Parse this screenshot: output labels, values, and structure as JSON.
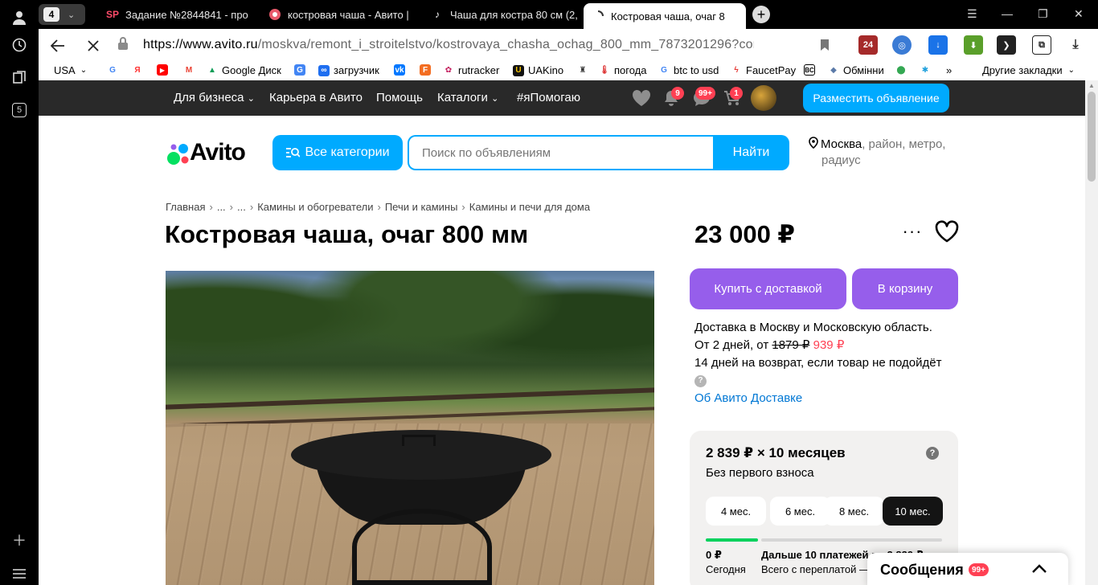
{
  "browser": {
    "tab_count": "4",
    "tabs": [
      {
        "favicon": "SP",
        "label": "Задание №2844841 - про"
      },
      {
        "favicon": "avito-icon",
        "label": "костровая чаша - Авито |"
      },
      {
        "favicon": "music-icon",
        "label": "Чаша для костра 80 см (2,"
      },
      {
        "favicon": "loading-icon",
        "label": "Костровая чаша, очаг 8"
      }
    ],
    "rail_badge": "5",
    "url_host": "https://www.avito.ru",
    "url_path": "/moskva/remont_i_stroitelstvo/kostrovaya_chasha_ochag_800_mm_7873201296?con...",
    "extension_badge": "24"
  },
  "bookmarks": [
    {
      "label": "USA",
      "icon": "chevron-down-icon"
    },
    {
      "label": "",
      "icon": "google-icon"
    },
    {
      "label": "",
      "icon": "yandex-icon"
    },
    {
      "label": "",
      "icon": "youtube-icon"
    },
    {
      "label": "",
      "icon": "gmail-icon"
    },
    {
      "label": "Google Диск",
      "icon": "google-drive-icon"
    },
    {
      "label": "",
      "icon": "translate-icon"
    },
    {
      "label": "загрузчик",
      "icon": "loader-icon"
    },
    {
      "label": "",
      "icon": "vk-icon"
    },
    {
      "label": "",
      "icon": "f-icon"
    },
    {
      "label": "rutracker",
      "icon": "rutracker-icon"
    },
    {
      "label": "UAKino",
      "icon": "uakino-icon"
    },
    {
      "label": "",
      "icon": "person-icon"
    },
    {
      "label": "погода",
      "icon": "thermometer-icon"
    },
    {
      "label": "btc to usd",
      "icon": "google-icon"
    },
    {
      "label": "FaucetPay",
      "icon": "faucetpay-icon"
    },
    {
      "label": "",
      "icon": "bc-icon"
    },
    {
      "label": "Обмінни",
      "icon": "exchange-icon"
    },
    {
      "label": "",
      "icon": "maps-icon"
    },
    {
      "label": "",
      "icon": "star-icon"
    },
    {
      "label": "»",
      "icon": ""
    },
    {
      "label": "Другие закладки",
      "icon": "chevron-down-icon"
    }
  ],
  "topbar": {
    "business": "Для бизнеса",
    "career": "Карьера в Авито",
    "help": "Помощь",
    "catalogs": "Каталоги",
    "ihelp": "#яПомогаю",
    "notifications_badge": "9",
    "messages_badge": "99+",
    "cart_badge": "1",
    "post_button": "Разместить объявление"
  },
  "header": {
    "logo": "Avito",
    "categories_button": "Все категории",
    "search_placeholder": "Поиск по объявлениям",
    "search_button": "Найти",
    "location_city": "Москва",
    "location_rest": ", район, метро,",
    "location_line2": "радиус"
  },
  "breadcrumbs": [
    "Главная",
    "...",
    "...",
    "Камины и обогреватели",
    "Печи и камины",
    "Камины и печи для дома"
  ],
  "listing": {
    "title": "Костровая чаша, очаг 800 мм",
    "price": "23 000 ₽",
    "more": "···",
    "buy_button": "Купить с доставкой",
    "cart_button": "В корзину"
  },
  "delivery": {
    "line1": "Доставка в Москву и Московскую область.",
    "line2_prefix": "От 2 дней, от ",
    "old_price": "1879 ₽",
    "new_price": "939 ₽",
    "line3": "14 дней на возврат, если товар не подойдёт",
    "help_mark": "?",
    "link": "Об Авито Доставке"
  },
  "installment": {
    "headline": "2 839 ₽ × 10 месяцев",
    "subline": "Без первого взноса",
    "help_mark": "?",
    "periods": [
      "4 мес.",
      "6 мес.",
      "8 мес.",
      "10 мес."
    ],
    "selected_period": "10 мес.",
    "today_amount": "0 ₽",
    "today_label": "Сегодня",
    "rest_amount": "Дальше 10 платежей по 2 839 ₽",
    "rest_label": "Всего с переплатой —"
  },
  "messages_widget": {
    "label": "Сообщения",
    "badge": "99+"
  }
}
